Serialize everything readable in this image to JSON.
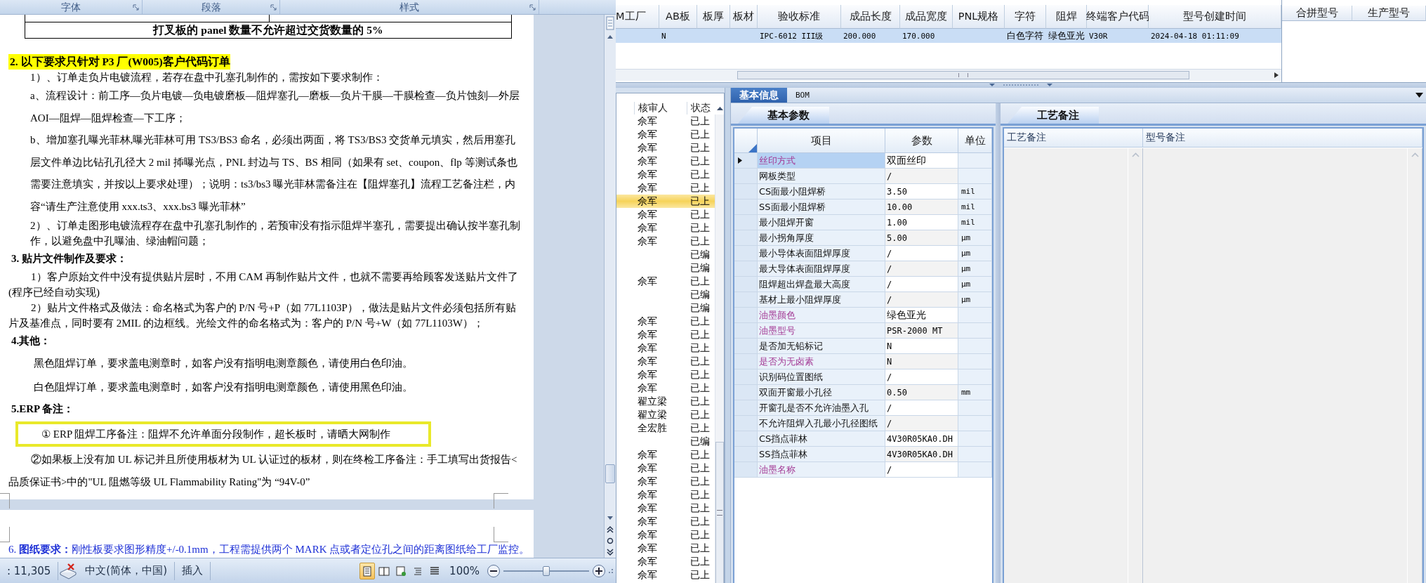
{
  "word": {
    "ribbon_groups": [
      "字体",
      "段落",
      "样式"
    ],
    "table_row": "打叉板的 panel 数量不允许超过交货数量的 5%",
    "paragraphs": [
      {
        "kind": "marked",
        "text": "2.  以下要求只针对 P3 厂(W005)客户代码订单"
      },
      {
        "kind": "block",
        "text": "1）、订单走负片电镀流程，若存在盘中孔塞孔制作的，需按如下要求制作："
      },
      {
        "kind": "loose",
        "text": "a、流程设计：前工序—负片电镀—负电镀磨板—阻焊塞孔—磨板—负片干膜—干膜检查—负片蚀刻—外层 AOI—阻焊—阻焊检查—下工序；"
      },
      {
        "kind": "loose",
        "text": "b、增加塞孔曝光菲林,曝光菲林可用 TS3/BS3 命名，必须出两面，将 TS3/BS3 交货单元填实，然后用塞孔层文件单边比钻孔孔径大 2 mil 揷曝光点，PNL 封边与 TS、BS 相同（如果有 set、coupon、flp 等测试条也需要注意填实，并按以上要求处理）；说明：ts3/bs3 曝光菲林需备注在【阻焊塞孔】流程工艺备注栏，内容“请生产注意使用 xxx.ts3、xxx.bs3 曝光菲林”"
      },
      {
        "kind": "block",
        "text": "2）、订单走图形电镀流程存在盘中孔塞孔制作的，若预审没有指示阻焊半塞孔，需要提出确认按半塞孔制作，以避免盘中孔曝油、绿油帽问题；"
      },
      {
        "kind": "heading",
        "text": "3. 贴片文件制作及要求："
      },
      {
        "kind": "first",
        "text": "1）客户原始文件中没有提供贴片层时，不用 CAM 再制作贴片文件，也就不需要再给顾客发送贴片文件了(程序已经自动实现)"
      },
      {
        "kind": "first",
        "text": "2）贴片文件格式及做法：命名格式为客户的 P/N 号+P（如 77L1103P），做法是贴片文件必须包括所有贴片及基准点，同时要有 2MIL 的边框线。光绘文件的命名格式为：客户的 P/N 号+W（如 77L1103W）；"
      },
      {
        "kind": "heading",
        "text": "4.其他："
      },
      {
        "kind": "indent",
        "text": "黑色阻焊订单，要求盖电测章时，如客户没有指明电测章颜色，请使用白色印油。"
      },
      {
        "kind": "indent",
        "text": "白色阻焊订单，要求盖电测章时，如客户没有指明电测章颜色，请使用黑色印油。"
      },
      {
        "kind": "heading",
        "text": "5.ERP 备注："
      },
      {
        "kind": "boxed",
        "text": "① ERP 阻焊工序备注：阻焊不允许单面分段制作，超长板时，请晒大网制作"
      },
      {
        "kind": "loosefirst",
        "text": "②如果板上没有加 UL 标记并且所使用板材为 UL 认证过的板材，则在终检工序备注：手工填写出货报告<品质保证书>中的\"UL 阻燃等级 UL Flammability Rating\"为 “94V-0”"
      }
    ],
    "next_page_text": "6. **图纸要求：**刚性板要求图形精度+/-0.1mm，工程需提供两个 MARK 点或者定位孔之间的距离图纸给工厂监控。",
    "status_bar": {
      "word_count": ": 11,305",
      "language": "中文(简体，中国)",
      "mode": "插入",
      "zoom": "100%",
      "views": [
        {
          "selected": true
        },
        {
          "selected": false
        },
        {
          "selected": false
        },
        {
          "selected": false
        },
        {
          "selected": false
        }
      ],
      "zoom_slider": {
        "level": 0.5
      }
    }
  },
  "main_grid": {
    "columns": [
      "M工厂",
      "AB板",
      "板厚",
      "板材",
      "验收标准",
      "成品长度",
      "成品宽度",
      "PNL规格",
      "字符",
      "阻焊",
      "终端客户代码",
      "型号创建时间"
    ],
    "rows": [
      {
        "selected": true,
        "cells": [
          null,
          "N",
          null,
          null,
          "IPC-6012 III级",
          "200.000",
          "170.000",
          null,
          "白色字符",
          "绿色亚光",
          "V30R",
          "2024-04-18 01:11:09"
        ]
      }
    ]
  },
  "merge_grid": {
    "columns": [
      "合拼型号",
      "生产型号"
    ]
  },
  "review_list": {
    "columns": [
      "核审人",
      "状态"
    ],
    "rows": [
      {
        "reviewer": "佘军",
        "status": "已上",
        "selected": false
      },
      {
        "reviewer": "佘军",
        "status": "已上",
        "selected": false
      },
      {
        "reviewer": "佘军",
        "status": "已上",
        "selected": false
      },
      {
        "reviewer": "佘军",
        "status": "已上",
        "selected": false
      },
      {
        "reviewer": "佘军",
        "status": "已上",
        "selected": false
      },
      {
        "reviewer": "佘军",
        "status": "已上",
        "selected": false
      },
      {
        "reviewer": "佘军",
        "status": "已上",
        "selected": true
      },
      {
        "reviewer": "佘军",
        "status": "已上",
        "selected": false
      },
      {
        "reviewer": "佘军",
        "status": "已上",
        "selected": false
      },
      {
        "reviewer": "佘军",
        "status": "已上",
        "selected": false
      },
      {
        "status": "已编",
        "selected": false
      },
      {
        "status": "已编",
        "selected": false
      },
      {
        "reviewer": "佘军",
        "status": "已上",
        "selected": false
      },
      {
        "status": "已编",
        "selected": false
      },
      {
        "status": "已编",
        "selected": false
      },
      {
        "reviewer": "佘军",
        "status": "已上",
        "selected": false
      },
      {
        "reviewer": "佘军",
        "status": "已上",
        "selected": false
      },
      {
        "reviewer": "佘军",
        "status": "已上",
        "selected": false
      },
      {
        "reviewer": "佘军",
        "status": "已上",
        "selected": false
      },
      {
        "reviewer": "佘军",
        "status": "已上",
        "selected": false
      },
      {
        "reviewer": "佘军",
        "status": "已上",
        "selected": false
      },
      {
        "reviewer": "翟立梁",
        "status": "已上",
        "selected": false
      },
      {
        "reviewer": "翟立梁",
        "status": "已上",
        "selected": false
      },
      {
        "reviewer": "全宏胜",
        "status": "已上",
        "selected": false
      },
      {
        "status": "已编",
        "selected": false
      },
      {
        "reviewer": "佘军",
        "status": "已上",
        "selected": false
      },
      {
        "reviewer": "佘军",
        "status": "已上",
        "selected": false
      },
      {
        "reviewer": "佘军",
        "status": "已上",
        "selected": false
      },
      {
        "reviewer": "佘军",
        "status": "已上",
        "selected": false
      },
      {
        "reviewer": "佘军",
        "status": "已上",
        "selected": false
      },
      {
        "reviewer": "佘军",
        "status": "已上",
        "selected": false
      },
      {
        "reviewer": "佘军",
        "status": "已上",
        "selected": false
      },
      {
        "reviewer": "佘军",
        "status": "已上",
        "selected": false
      },
      {
        "reviewer": "佘军",
        "status": "已上",
        "selected": false
      },
      {
        "reviewer": "佘军",
        "status": "已上",
        "selected": false
      }
    ]
  },
  "detail_tabs": [
    {
      "label": "基本信息",
      "selected": true
    },
    {
      "label": "BOM",
      "selected": false
    }
  ],
  "params": {
    "tab": "基本参数",
    "columns": [
      "项目",
      "参数",
      "单位"
    ],
    "rows": [
      {
        "name": "丝印方式",
        "value": "双面丝印",
        "highlighted": true,
        "selected": true
      },
      {
        "name": "网板类型",
        "value": "/",
        "highlighted": false,
        "selected": false
      },
      {
        "name": "CS面最小阻焊桥",
        "value": "3.50",
        "unit": "mil",
        "highlighted": false,
        "selected": false
      },
      {
        "name": "SS面最小阻焊桥",
        "value": "10.00",
        "unit": "mil",
        "highlighted": false,
        "selected": false
      },
      {
        "name": "最小阻焊开窗",
        "value": "1.00",
        "unit": "mil",
        "highlighted": false,
        "selected": false
      },
      {
        "name": "最小拐角厚度",
        "value": "5.00",
        "unit": "μm",
        "highlighted": false,
        "selected": false
      },
      {
        "name": "最小导体表面阻焊厚度",
        "value": "/",
        "unit": "μm",
        "highlighted": false,
        "selected": false
      },
      {
        "name": "最大导体表面阻焊厚度",
        "value": "/",
        "unit": "μm",
        "highlighted": false,
        "selected": false
      },
      {
        "name": "阻焊超出焊盘最大高度",
        "value": "/",
        "unit": "μm",
        "highlighted": false,
        "selected": false
      },
      {
        "name": "基材上最小阻焊厚度",
        "value": "/",
        "unit": "μm",
        "highlighted": false,
        "selected": false
      },
      {
        "name": "油墨颜色",
        "value": "绿色亚光",
        "highlighted": true,
        "selected": false
      },
      {
        "name": "油墨型号",
        "value": "PSR-2000 MT",
        "highlighted": true,
        "selected": false
      },
      {
        "name": "是否加无铅标记",
        "value": "N",
        "highlighted": false,
        "selected": false
      },
      {
        "name": "是否为无卤素",
        "value": "N",
        "highlighted": true,
        "selected": false
      },
      {
        "name": "识别码位置图纸",
        "value": "/",
        "highlighted": false,
        "selected": false
      },
      {
        "name": "双面开窗最小孔径",
        "value": "0.50",
        "unit": "mm",
        "highlighted": false,
        "selected": false
      },
      {
        "name": "开窗孔是否不允许油墨入孔",
        "value": "/",
        "highlighted": false,
        "selected": false
      },
      {
        "name": "不允许阻焊入孔最小孔径图纸",
        "value": "/",
        "highlighted": false,
        "selected": false
      },
      {
        "name": "CS挡点菲林",
        "value": "4V30R05KA0.DH",
        "highlighted": false,
        "selected": false
      },
      {
        "name": "SS挡点菲林",
        "value": "4V30R05KA0.DH",
        "highlighted": false,
        "selected": false
      },
      {
        "name": "油墨名称",
        "value": "/",
        "highlighted": true,
        "selected": false
      }
    ]
  },
  "notes": {
    "tab": "工艺备注",
    "columns": [
      "工艺备注",
      "型号备注"
    ]
  }
}
